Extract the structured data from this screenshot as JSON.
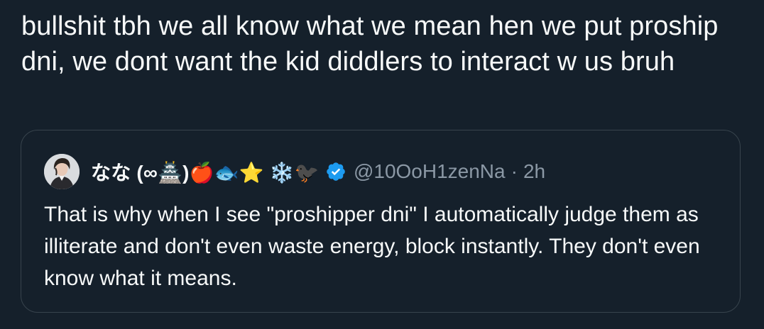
{
  "tweet": {
    "text": "bullshit tbh we all know what we mean hen we put proship dni, we dont want the kid diddlers to interact w us bruh"
  },
  "quote": {
    "display_name": "なな (∞🏯)🍎🐟⭐ ❄️🐦‍⬛",
    "handle": "@10OoH1zenNa",
    "separator": "·",
    "time": "2h",
    "text": "That is why when I see \"proshipper dni\" I automatically judge them as illiterate and don't even waste energy, block instantly. They don't even know what it means.",
    "verified_color": "#1d9bf0",
    "avatar_icon": "user-avatar"
  }
}
